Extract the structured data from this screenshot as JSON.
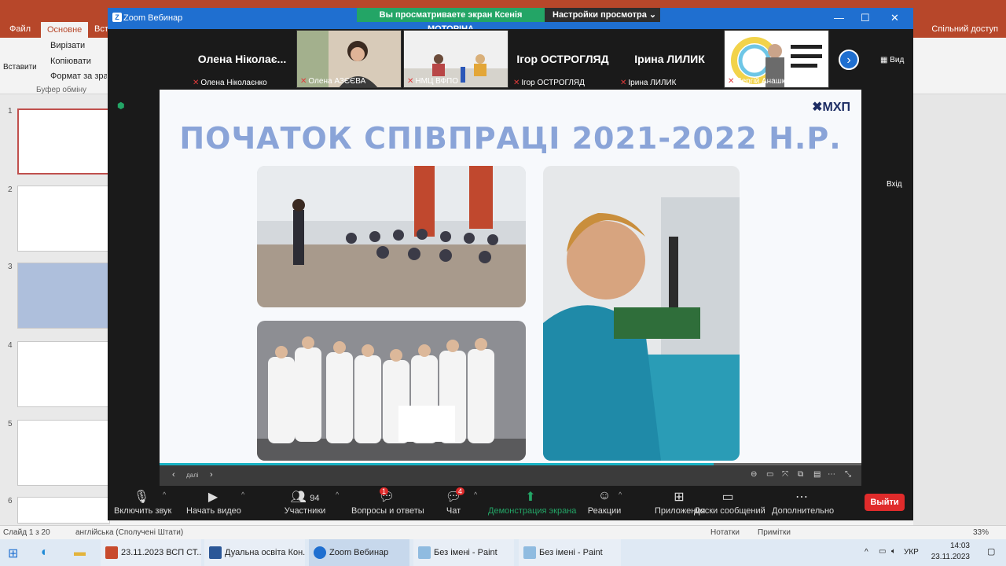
{
  "powerpoint": {
    "tabs": [
      "Файл",
      "Основне",
      "Вст"
    ],
    "share_label": "Спільний доступ",
    "ribbon": {
      "paste": "Вставити",
      "cut": "Вирізати",
      "copy": "Копіювати",
      "format": "Формат за зразком",
      "clipboard": "Буфер обміну"
    },
    "slide_numbers": [
      "1",
      "2",
      "3",
      "4",
      "5",
      "6"
    ],
    "status": {
      "slide_of": "Слайд 1 з 20",
      "language": "англійська (Сполучені Штати)",
      "notes": "Нотатки",
      "comments": "Примітки",
      "zoom": "33%"
    },
    "right_panel_label": "Вхід"
  },
  "zoom": {
    "title": "Zoom Вебинар",
    "share_banner": "Вы просматриваете экран Ксенія МОТОРІНА",
    "view_settings": "Настройки просмотра",
    "view_label": "Вид",
    "participants": [
      {
        "big_name": "Олена  Ніколає...",
        "label": "Олена Ніколаєнко"
      },
      {
        "label": "Олена АЗЄЄВА"
      },
      {
        "label": "НМЦ ВФПО"
      },
      {
        "big_name": "Ігор ОСТРОГЛЯД",
        "label": "Ігор ОСТРОГЛЯД"
      },
      {
        "big_name": "Ірина ЛИЛИК",
        "label": "Ірина ЛИЛИК"
      },
      {
        "label": "Сергій Анашкін"
      }
    ],
    "toolbar": {
      "mute": "Включить звук",
      "video": "Начать видео",
      "participants": "Участники",
      "participants_count": "94",
      "qa": "Вопросы и ответы",
      "qa_badge": "1",
      "chat": "Чат",
      "chat_badge": "4",
      "share": "Демонстрация экрана",
      "reactions": "Реакции",
      "apps": "Приложения",
      "whiteboards": "Доски сообщений",
      "more": "Дополнительно",
      "leave": "Выйти"
    },
    "slide": {
      "title": "ПОЧАТОК СПІВПРАЦІ 2021-2022 Н.Р.",
      "logo": "МХП",
      "progress": 0.79,
      "page_indicator": "далі"
    }
  },
  "taskbar": {
    "items": [
      "23.11.2023 ВСП СТ...",
      "Дуальна освіта Кон...",
      "Zoom Вебинар",
      "Без імені - Paint",
      "Без імені - Paint"
    ],
    "language": "УКР",
    "time": "14:03",
    "date": "23.11.2023"
  },
  "colors": {
    "zoom_blue": "#1f6fd0",
    "share_green": "#23a566",
    "ppt_red": "#b7472a",
    "leave_red": "#e02b2b"
  }
}
